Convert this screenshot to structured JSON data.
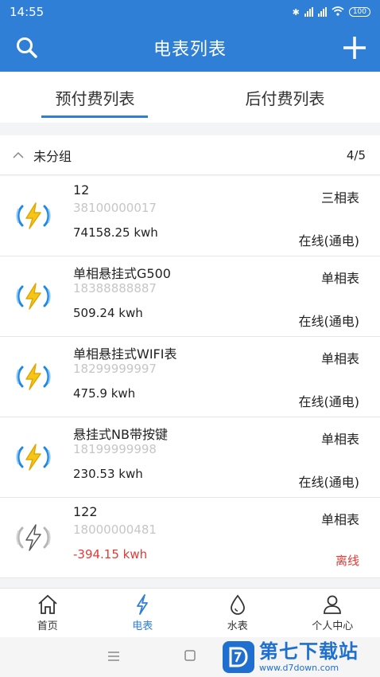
{
  "status_bar": {
    "time": "14:55",
    "battery": "100"
  },
  "header": {
    "title": "电表列表"
  },
  "tabs": [
    {
      "label": "预付费列表",
      "active": true
    },
    {
      "label": "后付费列表",
      "active": false
    }
  ],
  "group": {
    "name": "未分组",
    "count": "4/5"
  },
  "meters": [
    {
      "name": "12",
      "serial": "38100000017",
      "reading": "74158.25 kwh",
      "type": "三相表",
      "status": "在线(通电)",
      "online": true
    },
    {
      "name": "单相悬挂式G500",
      "serial": "18388888887",
      "reading": "509.24 kwh",
      "type": "单相表",
      "status": "在线(通电)",
      "online": true
    },
    {
      "name": "单相悬挂式WIFI表",
      "serial": "18299999997",
      "reading": "475.9 kwh",
      "type": "单相表",
      "status": "在线(通电)",
      "online": true
    },
    {
      "name": "悬挂式NB带按键",
      "serial": "18199999998",
      "reading": "230.53 kwh",
      "type": "单相表",
      "status": "在线(通电)",
      "online": true
    },
    {
      "name": "122",
      "serial": "18000000481",
      "reading": "-394.15 kwh",
      "type": "单相表",
      "status": "离线",
      "online": false
    }
  ],
  "bottom_nav": [
    {
      "label": "首页",
      "icon": "home-icon",
      "active": false
    },
    {
      "label": "电表",
      "icon": "lightning-icon",
      "active": true
    },
    {
      "label": "水表",
      "icon": "water-drop-icon",
      "active": false
    },
    {
      "label": "个人中心",
      "icon": "person-icon",
      "active": false
    }
  ],
  "watermark": {
    "title": "第七下载站",
    "url": "www.d7down.com"
  },
  "colors": {
    "primary": "#2f7fd6",
    "offline": "#e53935",
    "bolt_online": "#f5c518",
    "ring_online": "#1e88e5"
  }
}
